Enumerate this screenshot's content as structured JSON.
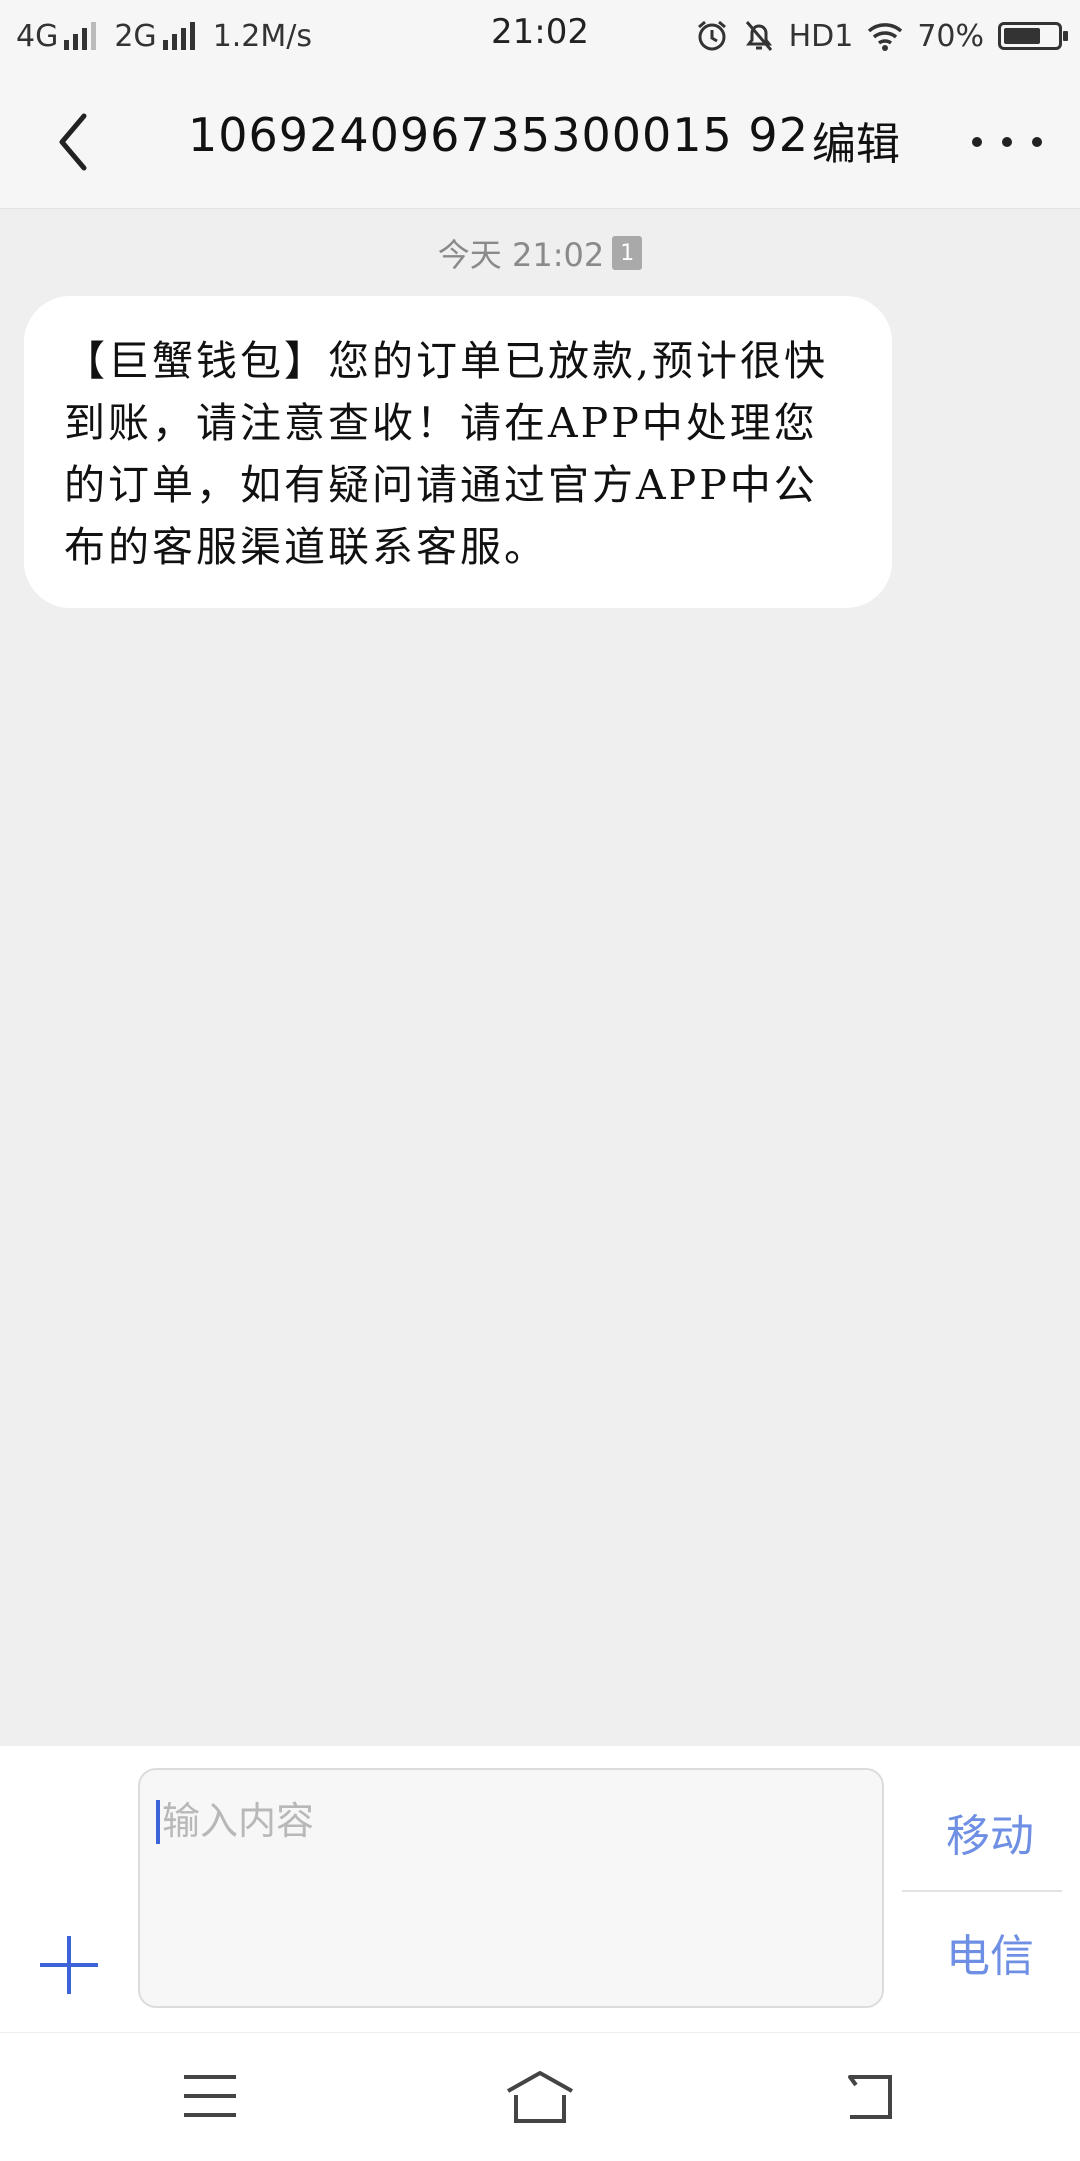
{
  "status_bar": {
    "network1": "4G",
    "network2": "2G",
    "speed": "1.2M/s",
    "time": "21:02",
    "hd": "HD1",
    "battery": "70%",
    "battery_level": 0.7
  },
  "header": {
    "title": "106924096735300015 92",
    "edit_label": "编辑"
  },
  "conversation": {
    "timestamp": "今天 21:02",
    "sim_badge": "1",
    "messages": [
      {
        "text": "【巨蟹钱包】您的订单已放款,预计很快到账，请注意查收！请在APP中处理您的订单，如有疑问请通过官方APP中公布的客服渠道联系客服。"
      }
    ]
  },
  "compose": {
    "placeholder": "输入内容",
    "send_option_1": "移动",
    "send_option_2": "电信"
  },
  "colors": {
    "accent": "#3c63d8",
    "send_text": "#6e8fe3",
    "background": "#efefef"
  }
}
